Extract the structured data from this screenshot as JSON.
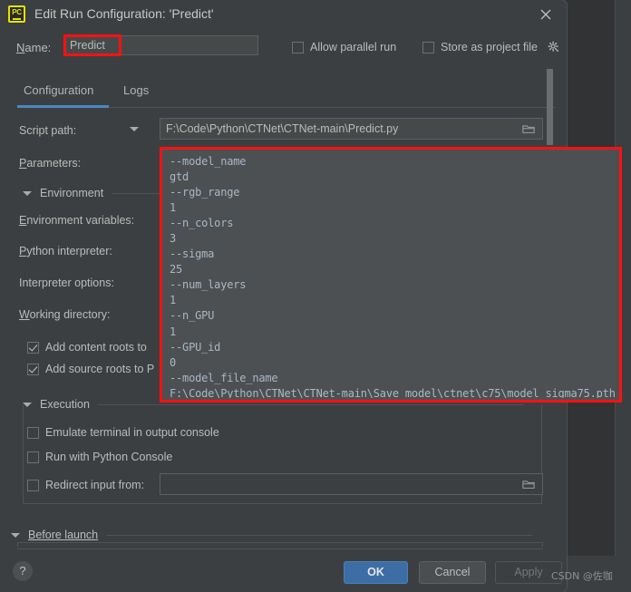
{
  "window": {
    "title": "Edit Run Configuration: 'Predict'",
    "app_icon": "pycharm-icon",
    "app_icon_text": "PC",
    "close_icon": "close-icon"
  },
  "name_row": {
    "label": "Name:",
    "label_mnemonic": "N",
    "value": "Predict",
    "highlight_color": "#fc1111"
  },
  "top_options": {
    "allow_parallel_run": {
      "label": "Allow parallel run",
      "checked": false
    },
    "store_as_project_file": {
      "label": "Store as project file",
      "checked": false
    },
    "gear_icon": "gear-icon"
  },
  "tabs": [
    {
      "label": "Configuration",
      "active": true
    },
    {
      "label": "Logs",
      "active": false
    }
  ],
  "accent_color": "#4a88c7",
  "fields": {
    "script_path": {
      "label": "Script path:",
      "value": "F:\\Code\\Python\\CTNet\\CTNet-main\\Predict.py",
      "browse_icon": "folder-icon"
    },
    "parameters": {
      "label": "Parameters:",
      "value": "--model_name\ngtd\n--rgb_range\n1\n--n_colors\n3\n--sigma\n25\n--num_layers\n1\n--n_GPU\n1\n--GPU_id\n0\n--model_file_name\nF:\\Code\\Python\\CTNet\\CTNet-main\\Save_model\\ctnet\\c75\\model_sigma75.pth",
      "highlight_color": "#fc1111"
    },
    "environment_variables": {
      "label": "Environment variables:"
    },
    "python_interpreter": {
      "label": "Python interpreter:",
      "label_mnemonic": "P"
    },
    "interpreter_options": {
      "label": "Interpreter options:"
    },
    "working_directory": {
      "label": "Working directory:",
      "label_mnemonic": "W"
    }
  },
  "sections": {
    "environment": {
      "label": "Environment",
      "expanded": true
    },
    "execution": {
      "label": "Execution",
      "expanded": true
    },
    "before_launch": {
      "label": "Before launch",
      "expanded": true
    }
  },
  "environment_options": [
    {
      "label": "Add content roots to",
      "checked": true
    },
    {
      "label": "Add source roots to P",
      "checked": true
    }
  ],
  "execution_options": [
    {
      "label": "Emulate terminal in output console",
      "checked": false
    },
    {
      "label": "Run with Python Console",
      "checked": false
    },
    {
      "label": "Redirect input from:",
      "checked": false
    }
  ],
  "redirect_input": {
    "value": "",
    "browse_icon": "folder-icon"
  },
  "buttons": {
    "help": "?",
    "ok": "OK",
    "cancel": "Cancel",
    "apply": "Apply"
  },
  "watermark": "CSDN @佐咖"
}
